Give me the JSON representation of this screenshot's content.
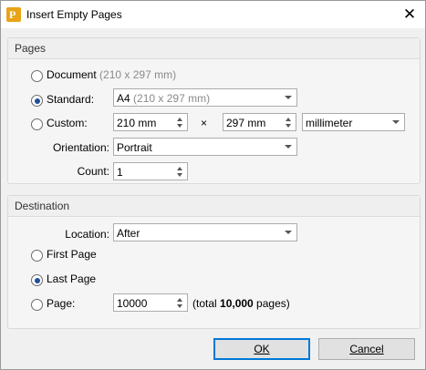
{
  "window": {
    "title": "Insert Empty Pages",
    "close_glyph": "✕",
    "app_icon_letter": "P"
  },
  "pages_section": {
    "heading": "Pages",
    "document_label": "Document",
    "document_hint": "(210 x 297 mm)",
    "standard_label": "Standard:",
    "standard_value": "A4",
    "standard_hint": "(210 x 297 mm)",
    "custom_label": "Custom:",
    "custom_width": "210 mm",
    "times_sign": "×",
    "custom_height": "297 mm",
    "unit_value": "millimeter",
    "orientation_label": "Orientation:",
    "orientation_value": "Portrait",
    "count_label": "Count:",
    "count_value": "1",
    "selected": "standard"
  },
  "destination_section": {
    "heading": "Destination",
    "location_label": "Location:",
    "location_value": "After",
    "first_page_label": "First Page",
    "last_page_label": "Last Page",
    "page_label": "Page:",
    "page_value": "10000",
    "total_prefix": "(total ",
    "total_value": "10,000",
    "total_suffix": " pages)",
    "selected": "last_page"
  },
  "buttons": {
    "ok_label": "OK",
    "cancel_label": "Cancel"
  }
}
